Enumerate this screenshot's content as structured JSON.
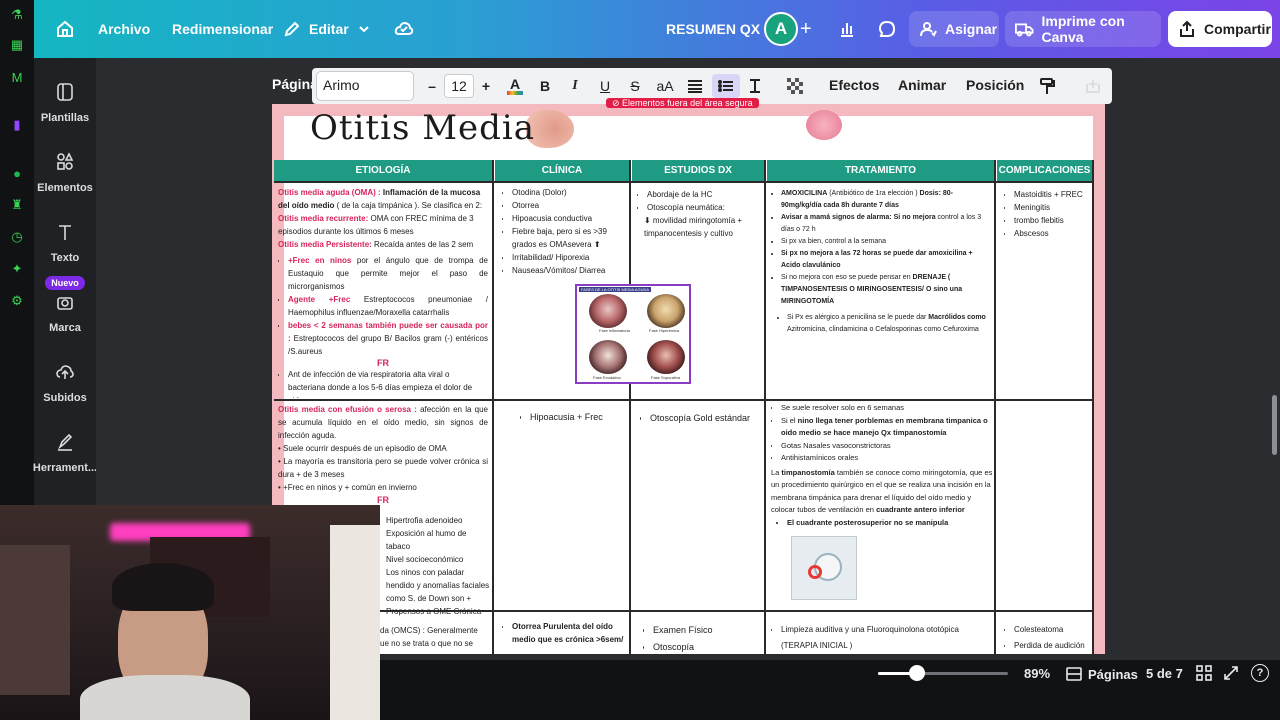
{
  "topbar": {
    "archivo": "Archivo",
    "redimensionar": "Redimensionar",
    "editar": "Editar",
    "doc_title": "RESUMEN QX",
    "avatar_letter": "A",
    "asignar": "Asignar",
    "imprime": "Imprime con Canva",
    "compartir": "Compartir"
  },
  "sidebar": {
    "items": [
      {
        "label": "Plantillas"
      },
      {
        "label": "Elementos"
      },
      {
        "label": "Texto"
      },
      {
        "label": "Marca",
        "badge": "Nuevo"
      },
      {
        "label": "Subidos"
      },
      {
        "label": "Herrament..."
      }
    ]
  },
  "toolbar": {
    "pagina": "Página",
    "font": "Arimo",
    "size": "12",
    "minus": "–",
    "plus": "+",
    "bold": "B",
    "italic": "I",
    "underline": "U",
    "strike": "S",
    "case": "aA",
    "efectos": "Efectos",
    "animar": "Animar",
    "posicion": "Posición"
  },
  "doc": {
    "banner": "⊘ Elementos fuera del área segura",
    "title": "Otitis Media",
    "headers": [
      "ETIOLOGÍA",
      "CLÍNICA",
      "ESTUDIOS DX",
      "TRATAMIENTO",
      "COMPLICACIONES"
    ],
    "row1": {
      "etiologia": {
        "t1a": "Otitis media aguda (OMA) :",
        "t1b": " Inflamación de la mucosa del oído medio",
        "t1c": " ( de la caja timpánica ). Se clasifica en 2:",
        "t2a": "Otitis media recurrente:",
        "t2b": " OMA con FREC mínima de 3 episodios durante los últimos 6 meses",
        "t3a": "Otitis media Persistente:",
        "t3b": " Recaída antes de las 2 sem",
        "b1a": "+Frec en ninos",
        "b1b": " por el ángulo que de trompa de Eustaquio que permite mejor el paso de microrganismos",
        "b2a": "Agente +Frec",
        "b2b": " Estreptococos pneumoniae / Haemophilus influenzae/Moraxella catarrhalis",
        "b3a": "bebes < 2 semanas también puede ser causada por :",
        "b3b": " Estreptococos del grupo B/ Bacilos gram (-) entéricos /S.aureus",
        "fr": "FR",
        "b4": "Ant de infección de via respiratoria alta viral o bacteriana donde a los 5-6 días empieza el dolor de oido"
      },
      "clinica": [
        "Otodina (Dolor)",
        "Otorrea",
        "Hipoacusia conductiva",
        "Fiebre baja, pero si es >39 grados es OMAsevera ⬆",
        "Irritabilidad/ Hiporexia",
        "Nauseas/Vómitos/ Diarrea"
      ],
      "estudios": [
        "Abordaje de la HC",
        "Otoscopía neumática:",
        "⬇ movilidad miringotomía + timpanocentesis y cultivo"
      ],
      "tratamiento": {
        "t1a": "AMOXICILINA",
        "t1b": " (Antibiótico de 1ra elección )",
        "t1c": " Dosis: 80-90mg/kg/día cada 8h durante 7 días",
        "t2a": "Avisar a mamá signos de alarma:",
        "t2b": " Si no mejora",
        "t2c": " control a los 3 días o 72 h",
        "t3": "Si px va bien, control a la semana",
        "t4": "Si px no mejora a las 72 horas se puede dar amoxicilina + Acido clavulánico",
        "t5a": "Si no mejora con eso se puede pensar en",
        "t5b": " DRENAJE ( TIMPANOSENTESIS O MIRINGOSENTESIS/ O sino una MIRINGOTOMÍA",
        "t6a": "Si Px es alérgico a penicilina se le puede dar",
        "t6b": " Macrólidos como",
        "t6c": " Azitromicina, clindamicina o Cefalosporinas como Cefuroxima"
      },
      "complicaciones": [
        "Mastoiditis + FREC",
        "Meningitis",
        "trombo flebitis",
        "Abscesos"
      ],
      "thumb_title": "FASES DE LA OTITIS MEDIA AGUDA",
      "thumb_labels": [
        "Fase Inflamatoria",
        "Fase Hiperémica",
        "Fase Exudativa",
        "Fase Supurativa"
      ]
    },
    "row2": {
      "etiologia": {
        "t1a": "Otitis media con efusión o serosa :",
        "t1b": " afección en la que se acumula líquido en el oído medio, sin signos de infección aguda.",
        "l1": "• Suele ocurrir después de un episodio de OMA",
        "l2": "• La mayoría es transitoria pero se puede volver crónica si dura + de 3 meses",
        "l3": "• +Frec en ninos y + común en invierno",
        "fr": "FR",
        "fr_list": [
          "Hipertrofia adenoideo",
          "Exposición al humo de tabaco",
          "Nivel socioeconómico",
          "Los ninos con paladar hendido y anomalías faciales como S. de Down son + Propensos a OME Crónica"
        ]
      },
      "clinica": "Hipoacusia + Frec",
      "estudios": "Otoscopía Gold estándar",
      "tratamiento": {
        "l1": "Se suele resolver solo en 6 semanas",
        "l2a": "Si el",
        "l2b": " nino llega tener porblemas en membrana timpanica o oido medio se hace manejo Qx timpanostomía",
        "l3": "Gotas Nasales vasoconstrictoras",
        "l4": "Antihistamínicos orales",
        "p1a": "La",
        "p1b": " timpanostomía",
        "p1c": " también se conoce como miringotomía, que es un procedimiento quirúrgico en el que se realiza una incisión en la membrana timpánica para drenar el líquido del oído medio y colocar tubos de ventilación en",
        "p1d": " cuadrante antero inferior",
        "l5": "El cuadrante posterosuperior no se manipula"
      }
    },
    "row3": {
      "etiologia": "da (OMCS) : Generalmente\nue no se trata o que no se",
      "clinica": "Otorrea Purulenta del oído medio que es crónica >6sem/",
      "estudios": [
        "Examen Físico",
        "Otoscopía"
      ],
      "tratamiento": "Limpieza auditiva y una Fluoroquinolona ototópica (TERAPIA INICIAL )",
      "complicaciones": [
        "Colesteatoma",
        "Perdida de audición"
      ]
    }
  },
  "bottombar": {
    "zoom": "89%",
    "paginas": "Páginas",
    "page_count": "5 de 7",
    "help": "?",
    "zoom_level": 0.3
  }
}
